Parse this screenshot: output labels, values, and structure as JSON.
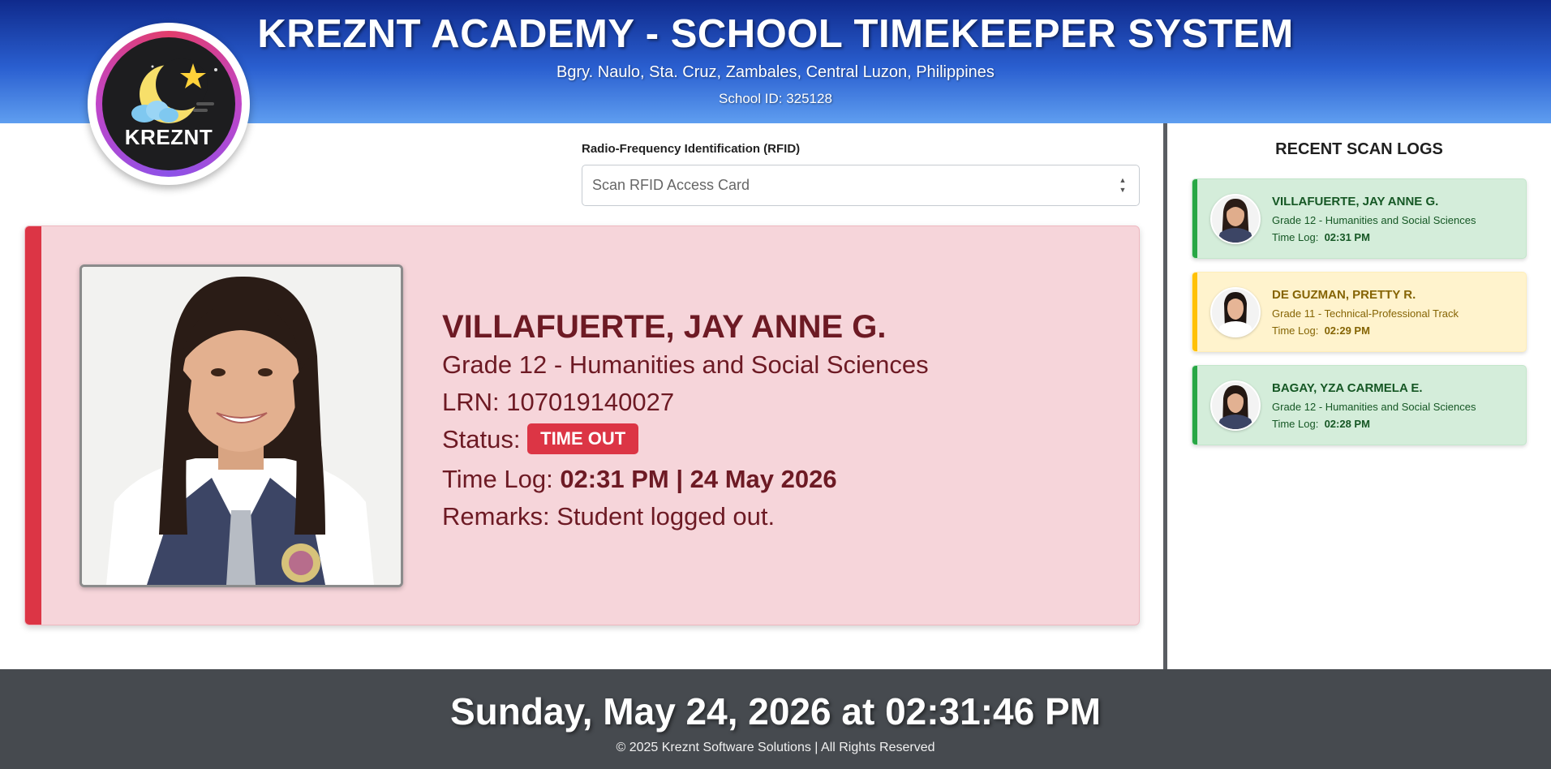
{
  "header": {
    "title": "KREZNT ACADEMY - SCHOOL TIMEKEEPER SYSTEM",
    "address": "Bgry. Naulo, Sta. Cruz, Zambales, Central Luzon, Philippines",
    "school_id": "School ID: 325128",
    "logo_text": "KREZNT"
  },
  "rfid": {
    "label": "Radio-Frequency Identification (RFID)",
    "placeholder": "Scan RFID Access Card",
    "value": ""
  },
  "student": {
    "name": "VILLAFUERTE, JAY ANNE G.",
    "grade": "Grade 12 - Humanities and Social Sciences",
    "lrn": "LRN: 107019140027",
    "status_label": "Status:",
    "status_badge": "TIME OUT",
    "time_log_label": "Time Log:",
    "time_log_value": "02:31 PM | 24 May 2026",
    "remarks": "Remarks: Student logged out.",
    "accent_color": "#dc3545"
  },
  "logs": {
    "title": "RECENT SCAN LOGS",
    "items": [
      {
        "name": "VILLAFUERTE, JAY ANNE G.",
        "grade": "Grade 12 - Humanities and Social Sciences",
        "time_label": "Time Log:",
        "time": "02:31 PM",
        "color": "green"
      },
      {
        "name": "DE GUZMAN, PRETTY R.",
        "grade": "Grade 11 - Technical-Professional Track",
        "time_label": "Time Log:",
        "time": "02:29 PM",
        "color": "yellow"
      },
      {
        "name": "BAGAY, YZA CARMELA E.",
        "grade": "Grade 12 - Humanities and Social Sciences",
        "time_label": "Time Log:",
        "time": "02:28 PM",
        "color": "green"
      }
    ]
  },
  "footer": {
    "clock": "Sunday, May 24, 2026 at 02:31:46 PM",
    "copyright": "© 2025 Kreznt Software Solutions | All Rights Reserved"
  },
  "icons": {
    "logo": "moon-star-cloud-logo",
    "photo": "student-photo",
    "avatars": "student-avatar"
  }
}
